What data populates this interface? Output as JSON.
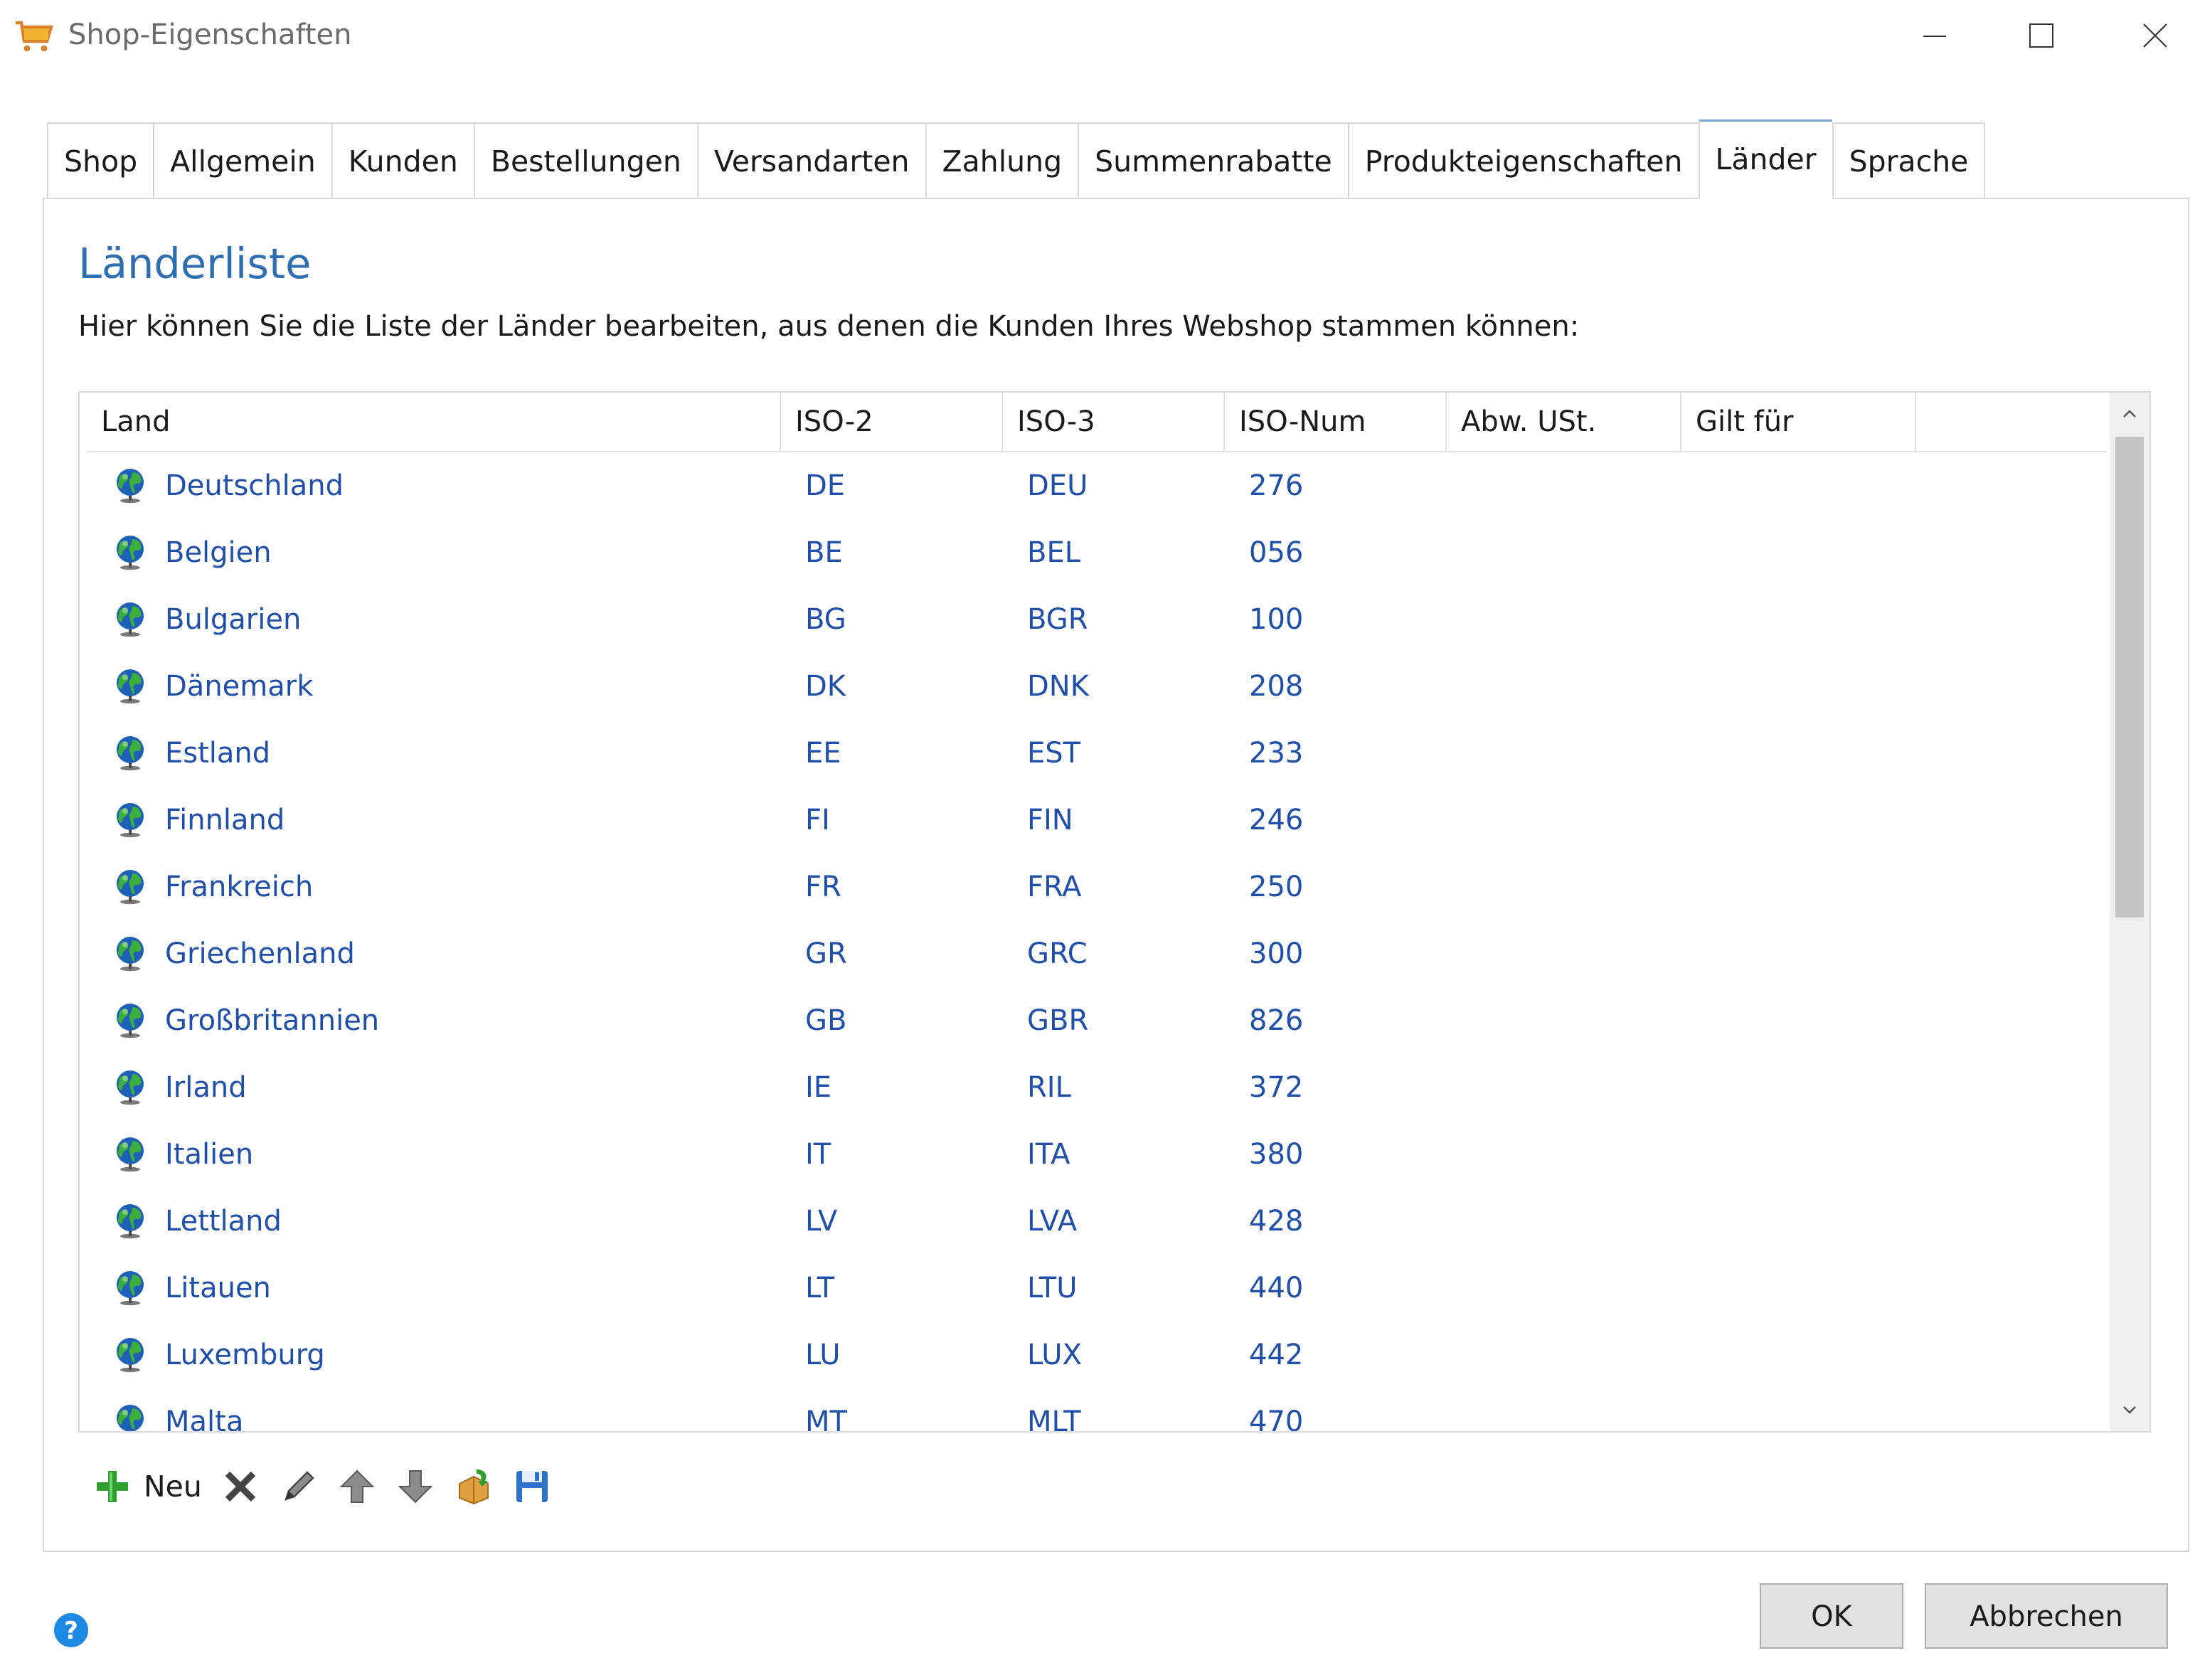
{
  "window": {
    "title": "Shop-Eigenschaften",
    "icons": {
      "app": "shopping-cart-icon",
      "minimize": "minimize-icon",
      "maximize": "maximize-icon",
      "close": "close-icon"
    }
  },
  "tabs": [
    {
      "label": "Shop"
    },
    {
      "label": "Allgemein"
    },
    {
      "label": "Kunden"
    },
    {
      "label": "Bestellungen"
    },
    {
      "label": "Versandarten"
    },
    {
      "label": "Zahlung"
    },
    {
      "label": "Summenrabatte"
    },
    {
      "label": "Produkteigenschaften"
    },
    {
      "label": "Länder",
      "active": true
    },
    {
      "label": "Sprache"
    }
  ],
  "section": {
    "title": "Länderliste",
    "description": "Hier können Sie die Liste der Länder bearbeiten, aus denen die Kunden Ihres Webshop stammen können:"
  },
  "list": {
    "columns": [
      "Land",
      "ISO-2",
      "ISO-3",
      "ISO-Num",
      "Abw. USt.",
      "Gilt für"
    ],
    "row_icon": "globe-icon",
    "rows": [
      {
        "land": "Deutschland",
        "iso2": "DE",
        "iso3": "DEU",
        "isonum": "276"
      },
      {
        "land": "Belgien",
        "iso2": "BE",
        "iso3": "BEL",
        "isonum": "056"
      },
      {
        "land": "Bulgarien",
        "iso2": "BG",
        "iso3": "BGR",
        "isonum": "100"
      },
      {
        "land": "Dänemark",
        "iso2": "DK",
        "iso3": "DNK",
        "isonum": "208"
      },
      {
        "land": "Estland",
        "iso2": "EE",
        "iso3": "EST",
        "isonum": "233"
      },
      {
        "land": "Finnland",
        "iso2": "FI",
        "iso3": "FIN",
        "isonum": "246"
      },
      {
        "land": "Frankreich",
        "iso2": "FR",
        "iso3": "FRA",
        "isonum": "250"
      },
      {
        "land": "Griechenland",
        "iso2": "GR",
        "iso3": "GRC",
        "isonum": "300"
      },
      {
        "land": "Großbritannien",
        "iso2": "GB",
        "iso3": "GBR",
        "isonum": "826"
      },
      {
        "land": "Irland",
        "iso2": "IE",
        "iso3": "RIL",
        "isonum": "372"
      },
      {
        "land": "Italien",
        "iso2": "IT",
        "iso3": "ITA",
        "isonum": "380"
      },
      {
        "land": "Lettland",
        "iso2": "LV",
        "iso3": "LVA",
        "isonum": "428"
      },
      {
        "land": "Litauen",
        "iso2": "LT",
        "iso3": "LTU",
        "isonum": "440"
      },
      {
        "land": "Luxemburg",
        "iso2": "LU",
        "iso3": "LUX",
        "isonum": "442"
      },
      {
        "land": "Malta",
        "iso2": "MT",
        "iso3": "MLT",
        "isonum": "470"
      }
    ]
  },
  "toolbar": {
    "new_label": "Neu",
    "icons": [
      "plus-icon",
      "delete-icon",
      "edit-icon",
      "arrow-up-icon",
      "arrow-down-icon",
      "import-icon",
      "save-icon"
    ]
  },
  "footer": {
    "ok_label": "OK",
    "cancel_label": "Abbrechen",
    "help_icon": "help-icon"
  },
  "colors": {
    "accent": "#2f6eb1",
    "row_text": "#1f4fa8",
    "border": "#d9d9d9",
    "button_bg": "#e1e1e1"
  }
}
